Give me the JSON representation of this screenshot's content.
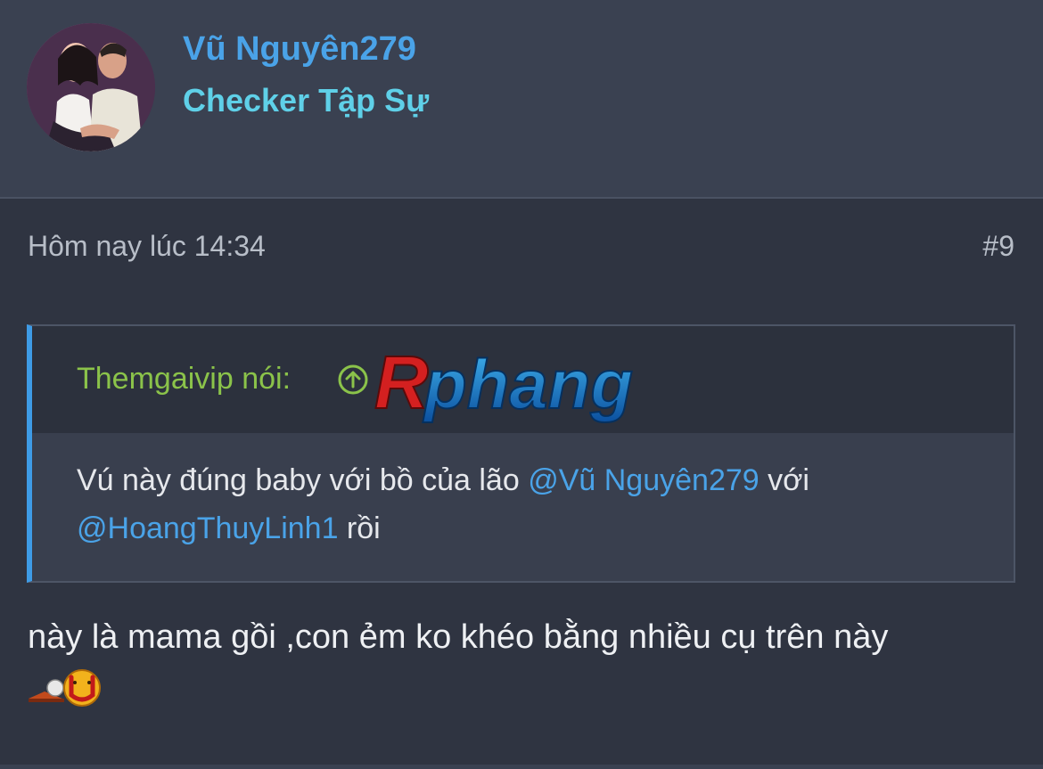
{
  "user": {
    "name": "Vũ Nguyên279",
    "title": "Checker Tập Sự"
  },
  "post": {
    "time": "Hôm nay lúc 14:34",
    "number": "#9",
    "quote": {
      "attribution": "Themgaivip nói:",
      "logo_text": "Rphang",
      "text_1": "Vú này đúng baby với bồ của lão ",
      "mention_1": "@Vũ Nguyên279",
      "text_2": " với",
      "mention_2": "@HoangThuyLinh1",
      "text_3": " rồi"
    },
    "body": "này là mama gồi ,con ẻm ko khéo bằng nhiều cụ trên này"
  },
  "colors": {
    "accent_blue": "#4aa3e8",
    "title_cyan": "#5fd0e8",
    "quote_green": "#8bc34a",
    "background": "#2f3441"
  },
  "icons": {
    "expand": "arrow-up-circle-icon",
    "smiley": "smiley-emoji-icon"
  }
}
